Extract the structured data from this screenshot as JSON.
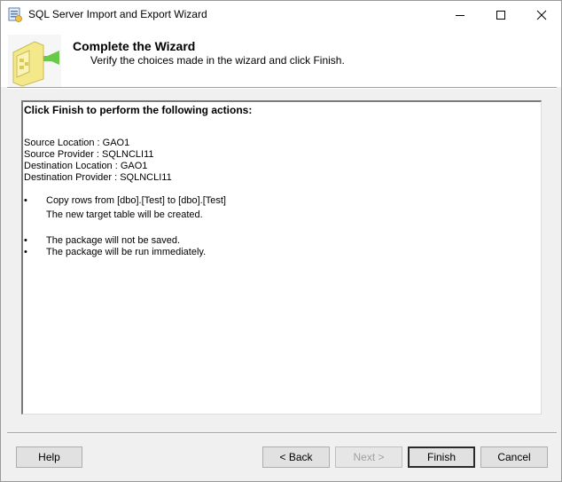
{
  "window": {
    "title": "SQL Server Import and Export Wizard"
  },
  "header": {
    "title": "Complete the Wizard",
    "subtitle": "Verify the choices made in the wizard and click Finish."
  },
  "summary": {
    "heading": "Click Finish to perform the following actions:",
    "details": [
      "Source Location : GAO1",
      "Source Provider : SQLNCLI11",
      "Destination Location : GAO1",
      "Destination Provider : SQLNCLI11"
    ],
    "bullet_glyph": "•",
    "action_1": {
      "text": "Copy rows from [dbo].[Test] to [dbo].[Test]",
      "subtext": "The new target table will be created."
    },
    "action_2": "The package will not be saved.",
    "action_3": "The package will be run immediately."
  },
  "buttons": {
    "help": "Help",
    "back": "< Back",
    "next": "Next >",
    "finish": "Finish",
    "cancel": "Cancel"
  },
  "icons": {
    "app": "wizard-app-icon",
    "minimize": "minimize-icon",
    "maximize": "maximize-icon",
    "close": "close-icon",
    "header": "wizard-header-graphic"
  },
  "colors": {
    "titlebar_bg": "#ffffff",
    "window_bg": "#f0f0f0",
    "button_bg": "#e1e1e1",
    "disabled_text": "#a0a0a0",
    "header_graphic_yellow": "#f3e98a",
    "header_graphic_green": "#6ac94a"
  }
}
